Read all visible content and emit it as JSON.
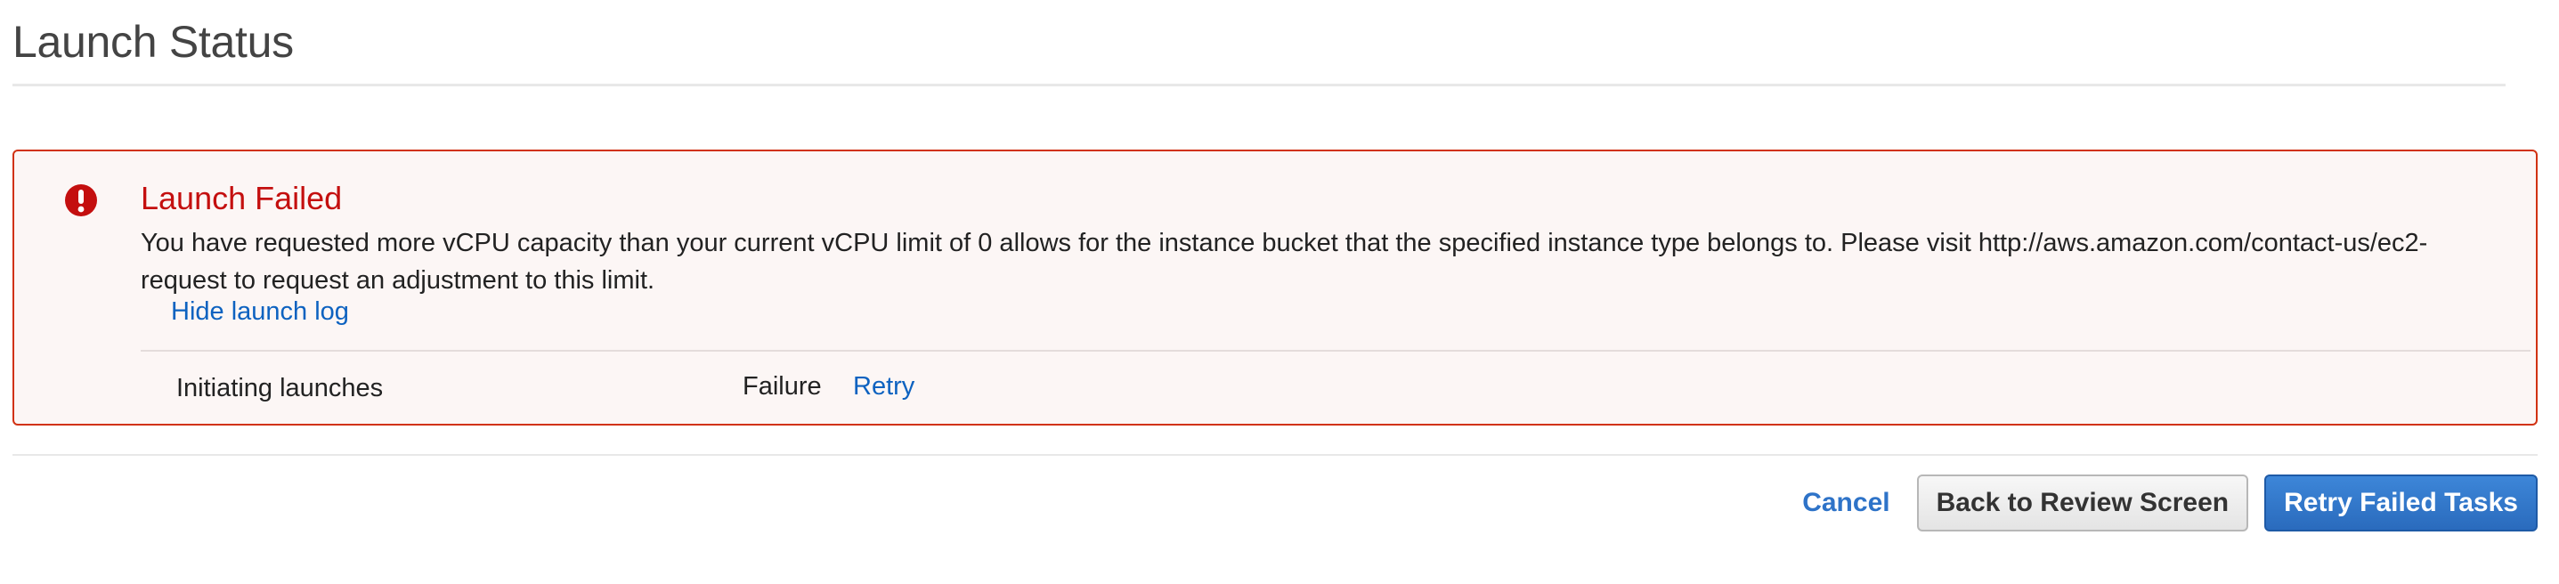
{
  "header": {
    "title": "Launch Status"
  },
  "alert": {
    "title": "Launch Failed",
    "icon": "exclamation-circle-icon",
    "message": "You have requested more vCPU capacity than your current vCPU limit of 0 allows for the instance bucket that the specified instance type belongs to. Please visit http://aws.amazon.com/contact-us/ec2-request to request an adjustment to this limit.",
    "log_toggle_label": "Hide launch log",
    "log": [
      {
        "task": "Initiating launches",
        "status": "Failure",
        "action": "Retry"
      }
    ]
  },
  "footer": {
    "cancel_label": "Cancel",
    "back_label": "Back to Review Screen",
    "retry_label": "Retry Failed Tasks"
  },
  "colors": {
    "error": "#d13212",
    "link": "#0d62c0",
    "primary": "#2a6bbd"
  }
}
